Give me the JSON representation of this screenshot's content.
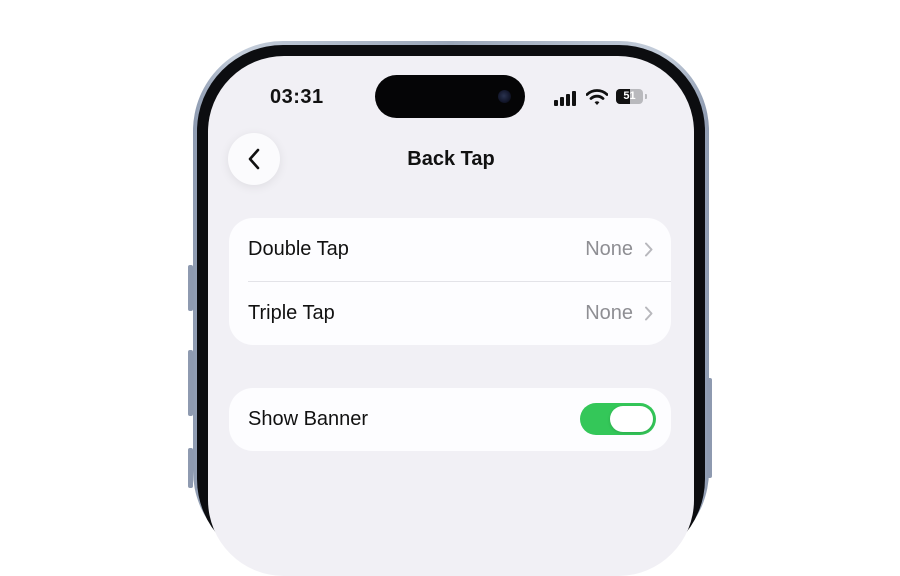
{
  "status_bar": {
    "time": "03:31",
    "battery_level": "51",
    "icons": [
      "cellular-signal-icon",
      "wifi-icon",
      "battery-icon"
    ]
  },
  "nav": {
    "title": "Back Tap",
    "back_icon": "chevron-left-icon"
  },
  "tap_actions": [
    {
      "label": "Double Tap",
      "value": "None"
    },
    {
      "label": "Triple Tap",
      "value": "None"
    }
  ],
  "banner": {
    "label": "Show Banner",
    "enabled": true
  },
  "colors": {
    "toggle_on": "#34c759",
    "background": "#f1f0f5",
    "secondary_text": "#8e8e93"
  }
}
